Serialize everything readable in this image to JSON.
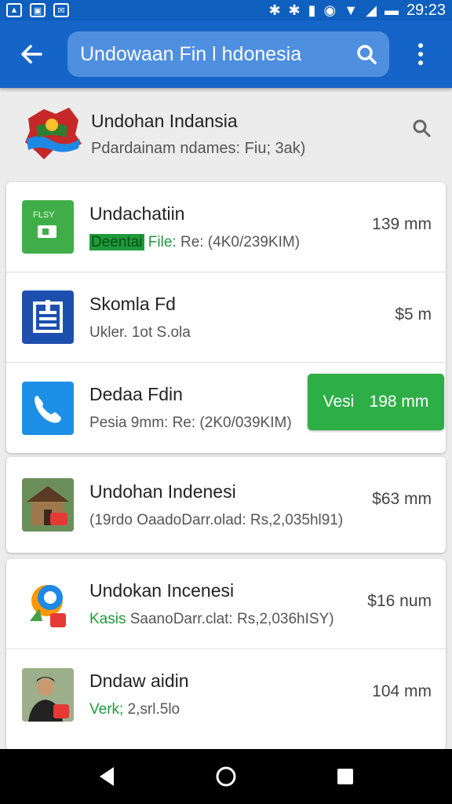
{
  "status_bar": {
    "time": "29:23",
    "icons": [
      "photo-icon",
      "image-icon",
      "mail-icon",
      "bluetooth-icon",
      "bluetooth-icon",
      "signal-icon",
      "alarm-icon",
      "wifi-icon",
      "signal-icon",
      "battery-icon"
    ]
  },
  "app_bar": {
    "search_text": "Undowaan Fin l hdonesia",
    "accent": "#1565c8"
  },
  "header": {
    "title": "Undohan Indansia",
    "subtitle": "Pdardainam ndames: Fiu; 3ak)"
  },
  "rows": [
    {
      "icon": "file-app-icon",
      "icon_text": "FLSY",
      "title": "Undachatiin",
      "sub_tag": "Deentai",
      "sub_green": "File:",
      "sub_rest": " Re: (4K0/239KIM)",
      "value": "139 mm"
    },
    {
      "icon": "document-app-icon",
      "title": "Skomla Fd",
      "sub": "Ukler. 1ot S.ola",
      "value": "$5 m"
    },
    {
      "icon": "phone-icon",
      "title": "Dedaa Fdin",
      "sub": "Pesia 9mm: Re: (2K0/039KIM)",
      "button_label": "Vesi",
      "button_value": "198 mm"
    },
    {
      "icon": "house-photo-icon",
      "title": "Undohan Indenesi",
      "sub": "(19rdo OaadoDarr.olad: Rs,2,035hl91)",
      "value": "$63 mm"
    },
    {
      "icon": "maps-app-icon",
      "title": "Undokan Incenesi",
      "sub_green": "Kasis",
      "sub_rest": " SaanoDarr.clat: Rs,2,036hISY)",
      "value": "$16 num"
    },
    {
      "icon": "person-photo-icon",
      "title": "Dndaw aidin",
      "sub_green": "Verk;",
      "sub_rest": " 2,srl.5lo",
      "value": "104 mm"
    }
  ],
  "colors": {
    "primary": "#1565c8",
    "green": "#2eae47",
    "nav": "#000000"
  }
}
